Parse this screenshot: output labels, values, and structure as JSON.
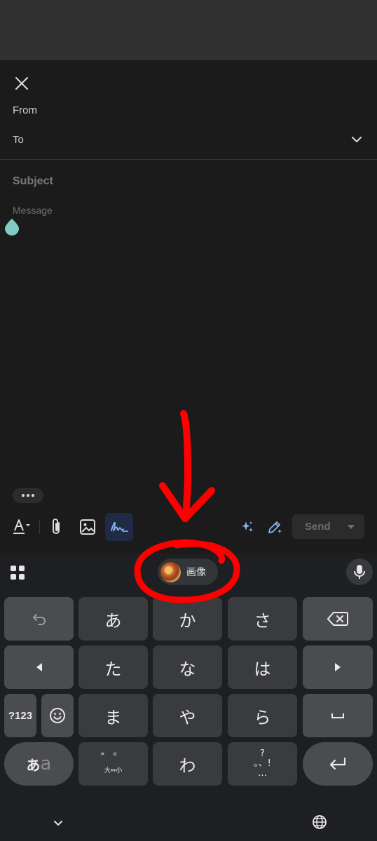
{
  "compose": {
    "from_label": "From",
    "to_label": "To",
    "subject_placeholder": "Subject",
    "message_placeholder": "Message"
  },
  "toolbar": {
    "send_label": "Send",
    "icons": [
      "text-format-icon",
      "attachment-icon",
      "image-icon",
      "signature-icon",
      "ai-sparkle-icon",
      "pen-sparkle-icon"
    ]
  },
  "keyboard": {
    "suggestion_chip_label": "画像",
    "rows": [
      [
        "↶",
        "あ",
        "か",
        "さ",
        "⌫"
      ],
      [
        "◀",
        "た",
        "な",
        "は",
        "▶"
      ],
      [
        "?123",
        "☺",
        "ま",
        "や",
        "ら",
        "␣"
      ],
      [
        "あa",
        "゛゜大⇔小",
        "わ",
        "?。、!…",
        "↵"
      ]
    ],
    "keys": {
      "undo": "↶",
      "a": "あ",
      "ka": "か",
      "sa": "さ",
      "left": "◀",
      "ta": "た",
      "na": "な",
      "ha": "は",
      "right": "▶",
      "num": "?123",
      "ma": "ま",
      "ya": "や",
      "ra": "ら",
      "space": "␣",
      "mode_a": "あ",
      "mode_latin": "a",
      "dakuten": "゛゜",
      "size_toggle": "大⇔小",
      "wa": "わ",
      "question": "?",
      "punct": "。、!",
      "ellipsis": "…",
      "enter": "↵"
    }
  },
  "colors": {
    "background": "#1b1b1b",
    "accent_blue": "#8ab4f8",
    "annotation_red": "#ff0000",
    "cursor_teal": "#80cbc4"
  }
}
